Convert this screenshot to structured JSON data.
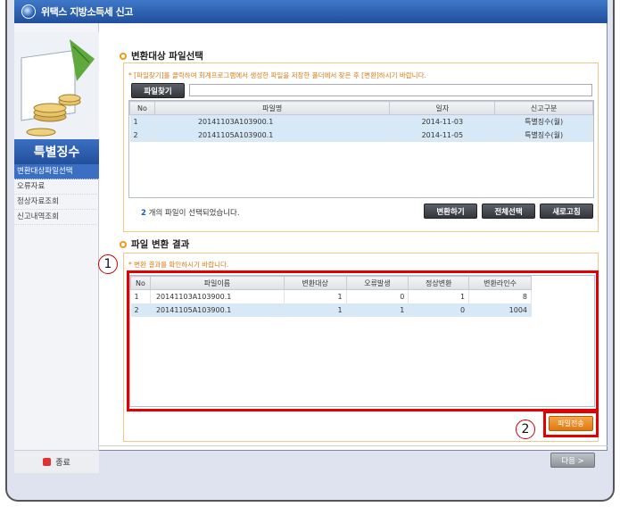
{
  "window": {
    "title": "위택스 지방소득세 신고"
  },
  "sidebar": {
    "heading": "특별징수",
    "items": [
      {
        "label": "변환대상파일선택",
        "active": true
      },
      {
        "label": "오류자료",
        "active": false
      },
      {
        "label": "정상자료조회",
        "active": false
      },
      {
        "label": "신고내역조회",
        "active": false
      }
    ],
    "exit_label": "종료"
  },
  "section1": {
    "title": "변환대상 파일선택",
    "note": "* [파일찾기]를 클릭하여 회계프로그램에서 생성한 파일을 저장한 폴더에서 찾은 후 [변환]하시기 바랍니다.",
    "find_button": "파일찾기",
    "path_value": "",
    "columns": [
      "No",
      "파일명",
      "일자",
      "신고구분"
    ],
    "rows": [
      [
        "1",
        "20141103A103900.1",
        "2014-11-03",
        "특별징수(월)"
      ],
      [
        "2",
        "20141105A103900.1",
        "2014-11-05",
        "특별징수(월)"
      ]
    ],
    "count_number": "2",
    "count_text": "개의 파일이 선택되었습니다.",
    "buttons": {
      "convert": "변환하기",
      "select_all": "전체선택",
      "refresh": "새로고침"
    }
  },
  "section2": {
    "title": "파일 변환 결과",
    "note": "* 변환 결과를 확인하시기 바랍니다.",
    "columns": [
      "No",
      "파일이름",
      "변환대상",
      "오류발생",
      "정상변환",
      "변환라인수"
    ],
    "rows": [
      [
        "1",
        "20141103A103900.1",
        "1",
        "0",
        "1",
        "8"
      ],
      [
        "2",
        "20141105A103900.1",
        "1",
        "1",
        "0",
        "1004"
      ]
    ],
    "send_button": "파일전송"
  },
  "annotations": {
    "one": "1",
    "two": "2"
  },
  "footer": {
    "next_button": "다음 >"
  },
  "colors": {
    "accent_orange": "#e0780f",
    "highlight_red": "#e30000",
    "title_blue": "#2a5fb0"
  },
  "icons": {
    "logo": "globe-logo-icon",
    "exit": "exit-icon",
    "bullet": "circle-bullet-icon"
  }
}
